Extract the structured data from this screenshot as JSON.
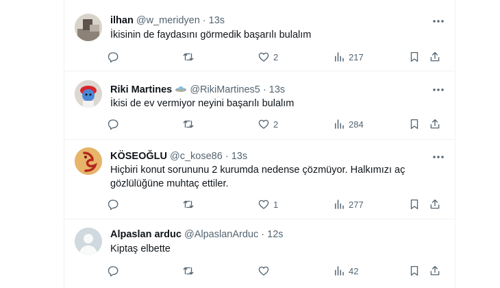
{
  "tweets": [
    {
      "name": "ilhan",
      "handle": "@w_meridyen",
      "dot": "·",
      "time": "13s",
      "text": "İkisinin de faydasını görmedik başarılı bulalım",
      "likes": "2",
      "views": "217"
    },
    {
      "name": "Riki Martines",
      "handle": "@RikiMartines5",
      "dot": "·",
      "time": "13s",
      "text": "İkisi de ev vermiyor neyini başarılı bulalım",
      "likes": "2",
      "views": "284"
    },
    {
      "name": "KÖSEOĞLU",
      "handle": "@c_kose86",
      "dot": "·",
      "time": "13s",
      "text_line1": "Hiçbiri konut sorununu 2 kurumda nedense çözmüyor. Halkımızı aç",
      "text_line2": "gözlülüğüne muhtaç ettiler.",
      "likes": "1",
      "views": "277"
    },
    {
      "name": "Alpaslan arduc",
      "handle": "@AlpaslanArduc",
      "dot": "·",
      "time": "12s",
      "text": "Kiptaş elbette",
      "views": "42"
    }
  ],
  "icons": {
    "reply": "reply-icon",
    "retweet": "retweet-icon",
    "like": "heart-icon",
    "views": "views-chart-icon",
    "bookmark": "bookmark-icon",
    "share": "share-icon",
    "more": "more-icon"
  },
  "colors": {
    "text": "#0f1419",
    "secondary": "#536471",
    "border": "#eff3f4"
  }
}
